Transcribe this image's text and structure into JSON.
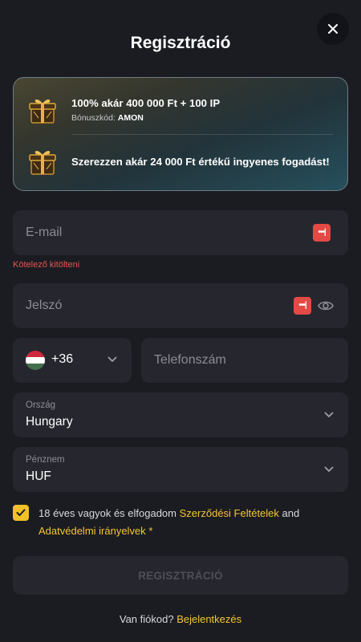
{
  "header": {
    "title": "Regisztráció"
  },
  "bonus": {
    "offer1": "100% akár 400 000 Ft + 100 IP",
    "code_label": "Bónuszkód:",
    "code_value": "AMON",
    "offer2": "Szerezzen akár 24 000 Ft értékű ingyenes fogadást!"
  },
  "form": {
    "email_placeholder": "E-mail",
    "email_error": "Kötelező kitölteni",
    "password_placeholder": "Jelszó",
    "phone_code": "+36",
    "phone_placeholder": "Telefonszám",
    "country_label": "Ország",
    "country_value": "Hungary",
    "currency_label": "Pénznem",
    "currency_value": "HUF",
    "terms_checked": true,
    "terms_prefix": "18 éves vagyok és elfogadom",
    "terms_link": "Szerződési Feltételek",
    "terms_and": "and",
    "privacy_link": "Adatvédelmi irányelvek",
    "required_mark": "*",
    "submit_label": "REGISZTRÁCIÓ"
  },
  "footer": {
    "has_account": "Van fiókod?",
    "login_link": "Bejelentkezés"
  },
  "colors": {
    "background": "#1b1c22",
    "field": "#26272e",
    "accent_yellow": "#f5c531",
    "error_red": "#e4574f",
    "password_manager_red": "#e34a45"
  },
  "icons": [
    "close-icon",
    "gift-icon",
    "password-manager-icon",
    "eye-icon",
    "hungary-flag-icon",
    "chevron-down-icon",
    "check-icon"
  ]
}
